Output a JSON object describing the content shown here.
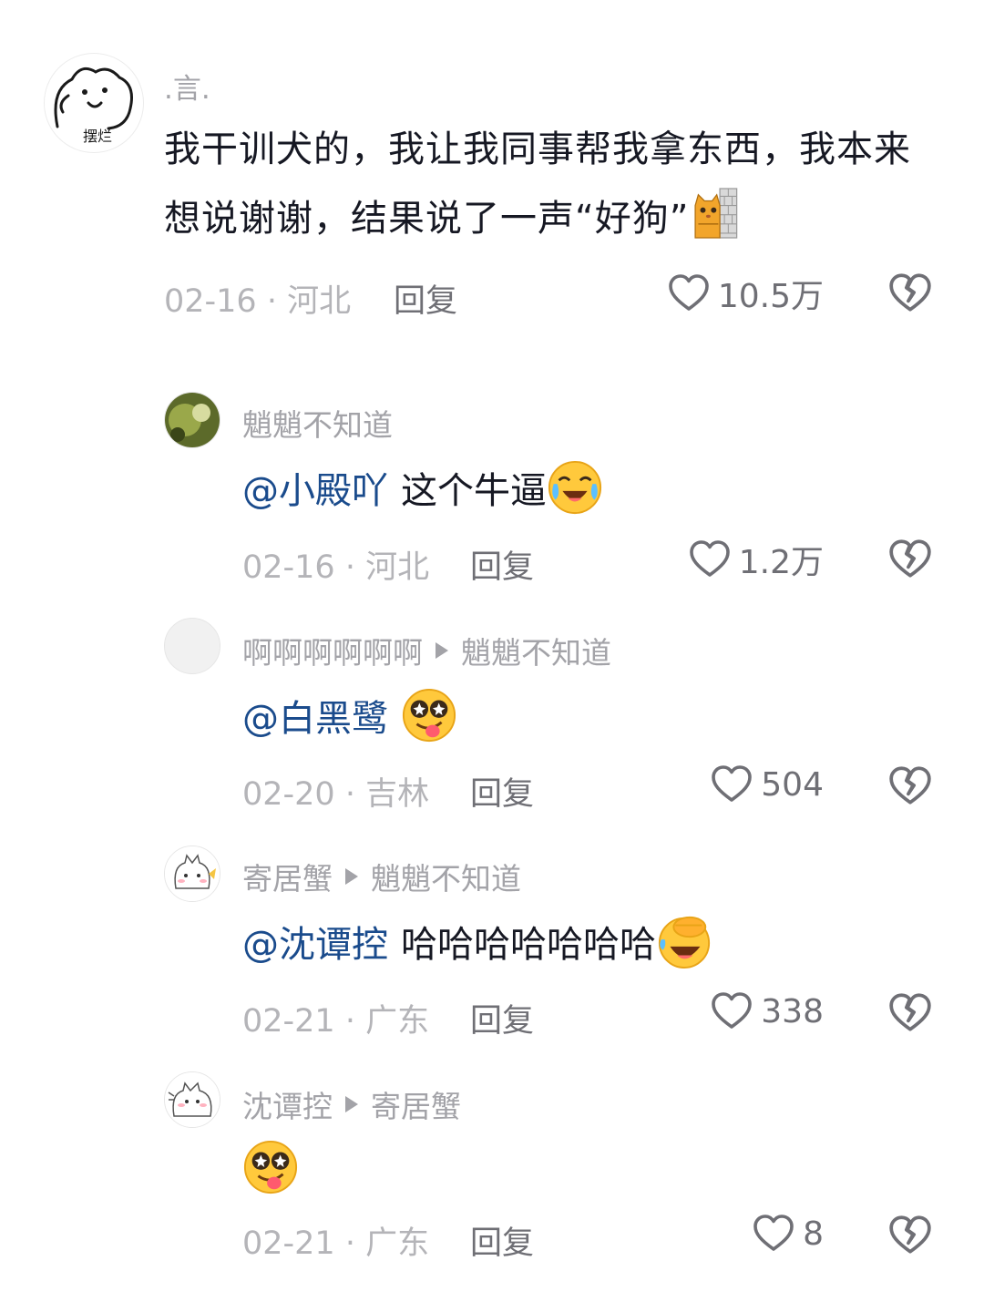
{
  "main_comment": {
    "username": ".言.",
    "avatar_text": "摆烂",
    "text": "我干训犬的，我让我同事帮我拿东西，我本来想说谢谢，结果说了一声“好狗”",
    "emoji": "cat-peeking-emoji",
    "date": "02-16",
    "location": "河北",
    "reply_label": "回复",
    "likes": "10.5万"
  },
  "replies": [
    {
      "username": "魈魈不知道",
      "reply_to": "",
      "mention": "@小殿吖",
      "text": "这个牛逼",
      "emoji": "crying-laughing-emoji",
      "date": "02-16",
      "location": "河北",
      "reply_label": "回复",
      "likes": "1.2万"
    },
    {
      "username": "啊啊啊啊啊啊",
      "reply_to": "魈魈不知道",
      "mention": "@白黑鹭",
      "text": "",
      "emoji": "silly-tongue-emoji",
      "date": "02-20",
      "location": "吉林",
      "reply_label": "回复",
      "likes": "504"
    },
    {
      "username": "寄居蟹",
      "reply_to": "魈魈不知道",
      "mention": "@沈谭控",
      "text": "哈哈哈哈哈哈哈",
      "emoji": "laughing-cover-face-emoji",
      "date": "02-21",
      "location": "广东",
      "reply_label": "回复",
      "likes": "338"
    },
    {
      "username": "沈谭控",
      "reply_to": "寄居蟹",
      "mention": "",
      "text": "",
      "emoji": "silly-tongue-emoji",
      "date": "02-21",
      "location": "广东",
      "reply_label": "回复",
      "likes": "8"
    }
  ],
  "icons": {
    "like": "heart-outline-icon",
    "dislike": "broken-heart-icon",
    "reply_arrow": "triangle-right-icon"
  },
  "colors": {
    "mention": "#1a4b8c",
    "meta": "#b4b4b8",
    "username": "#a3a3a8"
  }
}
